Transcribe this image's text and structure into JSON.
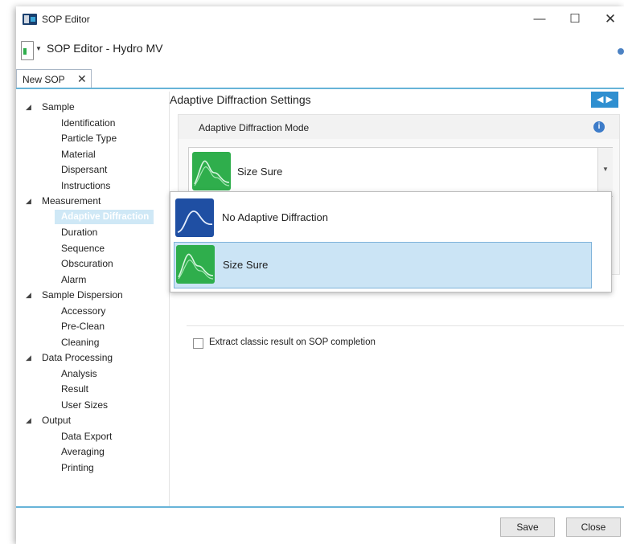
{
  "window": {
    "title": "SOP Editor",
    "minimize": "—",
    "maximize": "☐",
    "close": "✕"
  },
  "document": {
    "title": "SOP Editor - Hydro MV",
    "dropdown_glyph": "▼"
  },
  "tab": {
    "label": "New SOP",
    "close": "✕"
  },
  "nav": {
    "expanded_glyph": "◢",
    "groups": [
      {
        "label": "Sample",
        "children": [
          "Identification",
          "Particle Type",
          "Material",
          "Dispersant",
          "Instructions"
        ]
      },
      {
        "label": "Measurement",
        "children": [
          "Adaptive Diffraction",
          "Duration",
          "Sequence",
          "Obscuration",
          "Alarm"
        ]
      },
      {
        "label": "Sample Dispersion",
        "children": [
          "Accessory",
          "Pre-Clean",
          "Cleaning"
        ]
      },
      {
        "label": "Data Processing",
        "children": [
          "Analysis",
          "Result",
          "User Sizes"
        ]
      },
      {
        "label": "Output",
        "children": [
          "Data Export",
          "Averaging",
          "Printing"
        ]
      }
    ],
    "selected": "Adaptive Diffraction"
  },
  "main": {
    "section_title": "Adaptive Diffraction Settings",
    "nav_arrows": "◀ ▶",
    "panel_header": "Adaptive Diffraction Mode",
    "info_glyph": "i",
    "selected_mode": "Size Sure",
    "combo_arrow": "▼",
    "options": [
      "No Adaptive Diffraction",
      "Size Sure"
    ],
    "checkbox_label": "Extract classic result on SOP completion"
  },
  "footer": {
    "save": "Save",
    "close": "Close"
  },
  "colors": {
    "accent": "#2f8fd0",
    "rule": "#67b4d8",
    "selection": "#cbe4f5",
    "thumb_green": "#2fae4c",
    "thumb_blue": "#1f4fa3"
  }
}
